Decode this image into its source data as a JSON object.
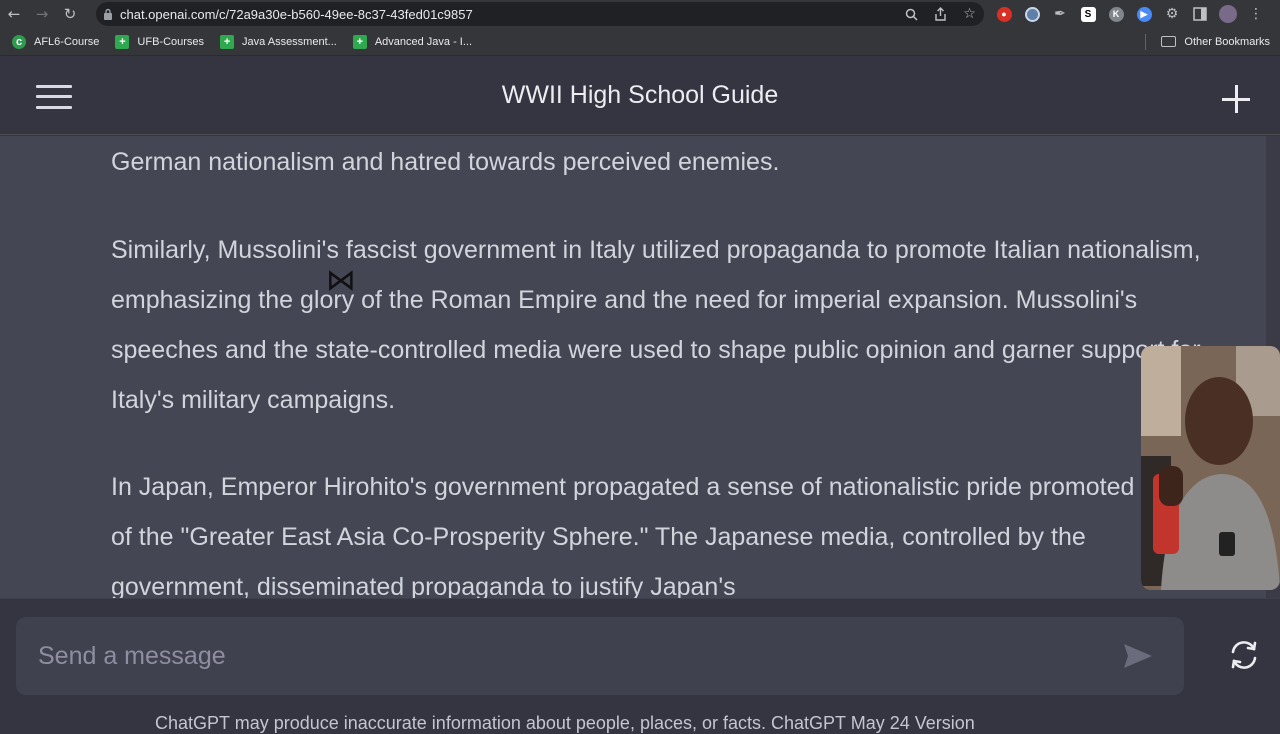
{
  "browser": {
    "url": "chat.openai.com/c/72a9a30e-b560-49ee-8c37-43fed01c9857",
    "bookmarks": [
      {
        "label": "AFL6-Course",
        "icon": "circle-c-icon"
      },
      {
        "label": "UFB-Courses",
        "icon": "green-plus-icon"
      },
      {
        "label": "Java Assessment...",
        "icon": "green-plus-icon"
      },
      {
        "label": "Advanced Java - I...",
        "icon": "green-plus-icon"
      }
    ],
    "other_bookmarks": "Other Bookmarks",
    "ext_letters": {
      "s": "S",
      "k": "K"
    }
  },
  "header": {
    "title": "WWII High School Guide"
  },
  "messages": {
    "paragraphs": [
      "German nationalism and hatred towards perceived enemies.",
      "Similarly, Mussolini's fascist government in Italy utilized propaganda to promote Italian nationalism, emphasizing the glory of the Roman Empire and the need for imperial expansion. Mussolini's speeches and the state-controlled media were used to shape public opinion and garner support for Italy's military campaigns.",
      "In Japan, Emperor Hirohito's government propagated a sense of nationalistic pride promoted the idea of the \"Greater East Asia Co-Prosperity Sphere.\" The Japanese media, controlled by the government, disseminated propaganda to justify Japan's"
    ]
  },
  "composer": {
    "placeholder": "Send a message"
  },
  "footer": {
    "note": "ChatGPT may produce inaccurate information about people, places, or facts. ChatGPT May 24 Version"
  },
  "colors": {
    "background": "#343541",
    "message_bg": "#444654",
    "text": "#d1d5db"
  }
}
